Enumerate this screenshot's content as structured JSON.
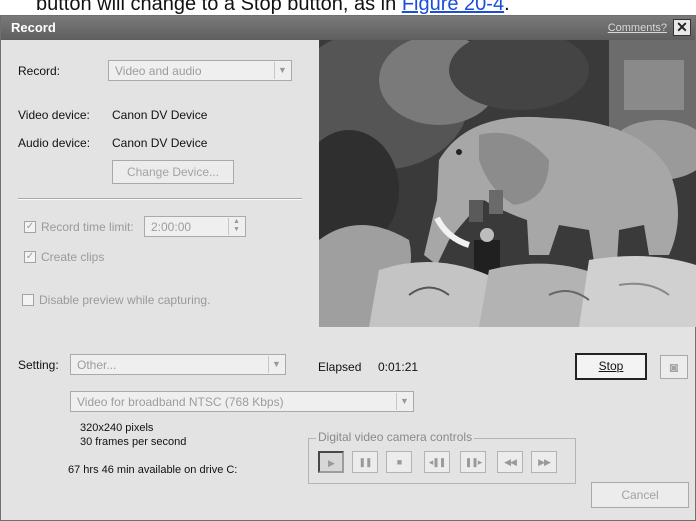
{
  "page_text": {
    "prefix": "button will change to a Stop button, as in ",
    "link": "Figure 20-4",
    "suffix": "."
  },
  "dialog": {
    "title": "Record",
    "comments_link": "Comments?",
    "close_symbol": "✕"
  },
  "record": {
    "label": "Record:",
    "value": "Video and audio"
  },
  "devices": {
    "video_label": "Video device:",
    "video_value": "Canon DV Device",
    "audio_label": "Audio device:",
    "audio_value": "Canon DV Device",
    "change_button": "Change Device..."
  },
  "options": {
    "time_limit_label": "Record time limit:",
    "time_limit_value": "2:00:00",
    "time_limit_checked": true,
    "create_clips_label": "Create clips",
    "create_clips_checked": true,
    "disable_preview_label": "Disable preview while capturing.",
    "disable_preview_checked": false
  },
  "setting": {
    "label": "Setting:",
    "value": "Other...",
    "profile": "Video for broadband NTSC (768 Kbps)",
    "line1": "320x240 pixels",
    "line2": "30 frames per second",
    "disk": "67 hrs  46 min available on drive C:"
  },
  "elapsed": {
    "label": "Elapsed",
    "value": "0:01:21"
  },
  "buttons": {
    "stop": "Stop",
    "cancel": "Cancel"
  },
  "camera_controls": {
    "title": "Digital video camera controls",
    "icons": [
      "play-icon",
      "pause-icon",
      "stop-icon",
      "previous-frame-icon",
      "next-frame-icon",
      "rewind-icon",
      "fast-forward-icon"
    ]
  },
  "icon_glyphs": {
    "play": "▶",
    "pause": "❚❚",
    "stop": "■",
    "prev": "◂❚❚",
    "next": "❚❚▸",
    "rew": "◀◀",
    "ff": "▶▶",
    "camera": "◙"
  }
}
